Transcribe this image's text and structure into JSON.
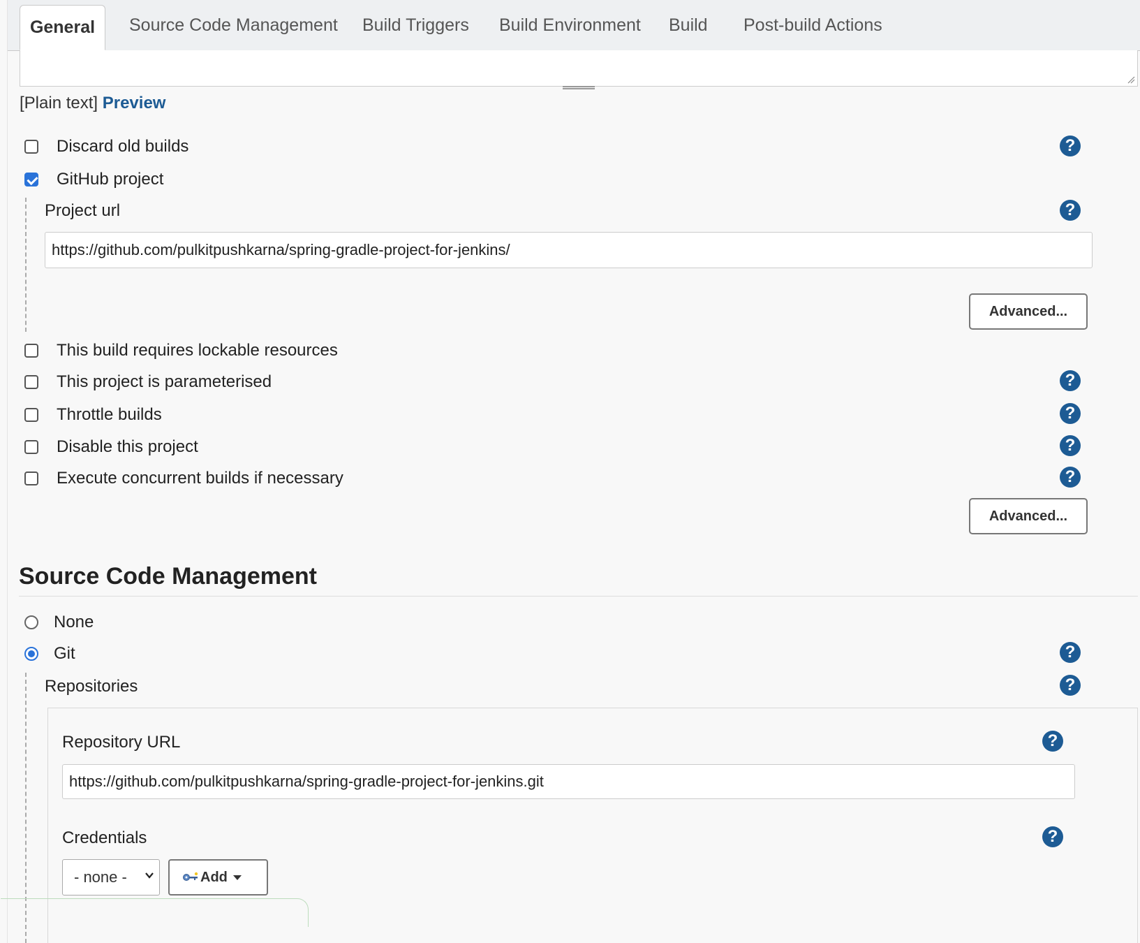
{
  "tabs": [
    {
      "label": "General",
      "active": true
    },
    {
      "label": "Source Code Management"
    },
    {
      "label": "Build Triggers"
    },
    {
      "label": "Build Environment"
    },
    {
      "label": "Build"
    },
    {
      "label": "Post-build Actions"
    }
  ],
  "description": {
    "format_text": "[Plain text]",
    "preview_link": "Preview"
  },
  "general": {
    "discard_old_builds": "Discard old builds",
    "github_project": "GitHub project",
    "project_url_label": "Project url",
    "project_url_value": "https://github.com/pulkitpushkarna/spring-gradle-project-for-jenkins/",
    "advanced_label": "Advanced...",
    "lockable_resources": "This build requires lockable resources",
    "parameterised": "This project is parameterised",
    "throttle_builds": "Throttle builds",
    "disable_project": "Disable this project",
    "concurrent_builds": "Execute concurrent builds if necessary",
    "advanced_label_2": "Advanced..."
  },
  "scm": {
    "title": "Source Code Management",
    "none_label": "None",
    "git_label": "Git",
    "repositories_label": "Repositories",
    "repo_url_label": "Repository URL",
    "repo_url_value": "https://github.com/pulkitpushkarna/spring-gradle-project-for-jenkins.git",
    "credentials_label": "Credentials",
    "credentials_selected": "- none -",
    "add_label": "Add"
  },
  "help_glyph": "?",
  "colors": {
    "link": "#1d5b94",
    "accent": "#2a73d9",
    "help": "#1d5b94"
  }
}
